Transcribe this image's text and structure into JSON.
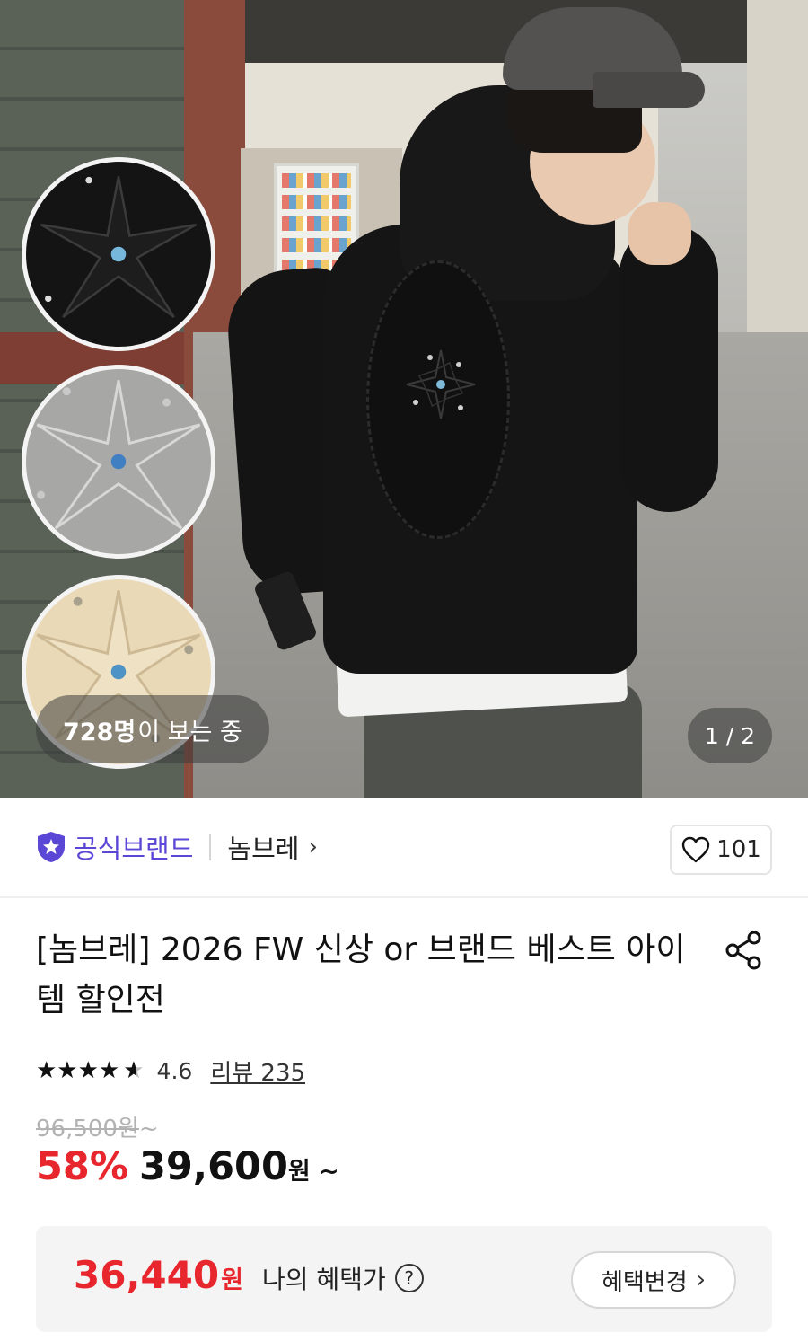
{
  "gallery": {
    "viewers_count": "728명",
    "viewers_suffix": "이 보는 중",
    "pager": "1 / 2",
    "swatches": [
      "black",
      "gray",
      "beige"
    ]
  },
  "brand": {
    "official_label": "공식브랜드",
    "name": "놈브레",
    "chevron": "›",
    "like_count": "101"
  },
  "product": {
    "title": "[놈브레] 2026 FW 신상 or 브랜드 베스트 아이템 할인전",
    "rating": {
      "stars": "★★★★",
      "half_star": "★",
      "value": 4.6,
      "value_text": "4.6",
      "review_label": "리뷰 235"
    },
    "original_price": "96,500원",
    "original_suffix": "~",
    "discount": "58%",
    "sale_price": "39,600",
    "sale_suffix": "원 ~"
  },
  "benefit": {
    "price": "36,440",
    "unit": "원",
    "label": "나의 혜택가",
    "help_icon": "?",
    "change_button": "혜택변경",
    "chevron": "›"
  },
  "colors": {
    "accent": "#5b47d6",
    "discount": "#e8262d"
  },
  "icons": [
    "official-badge-icon",
    "heart-icon",
    "share-icon",
    "question-icon",
    "chevron-right-icon",
    "star-icon"
  ]
}
